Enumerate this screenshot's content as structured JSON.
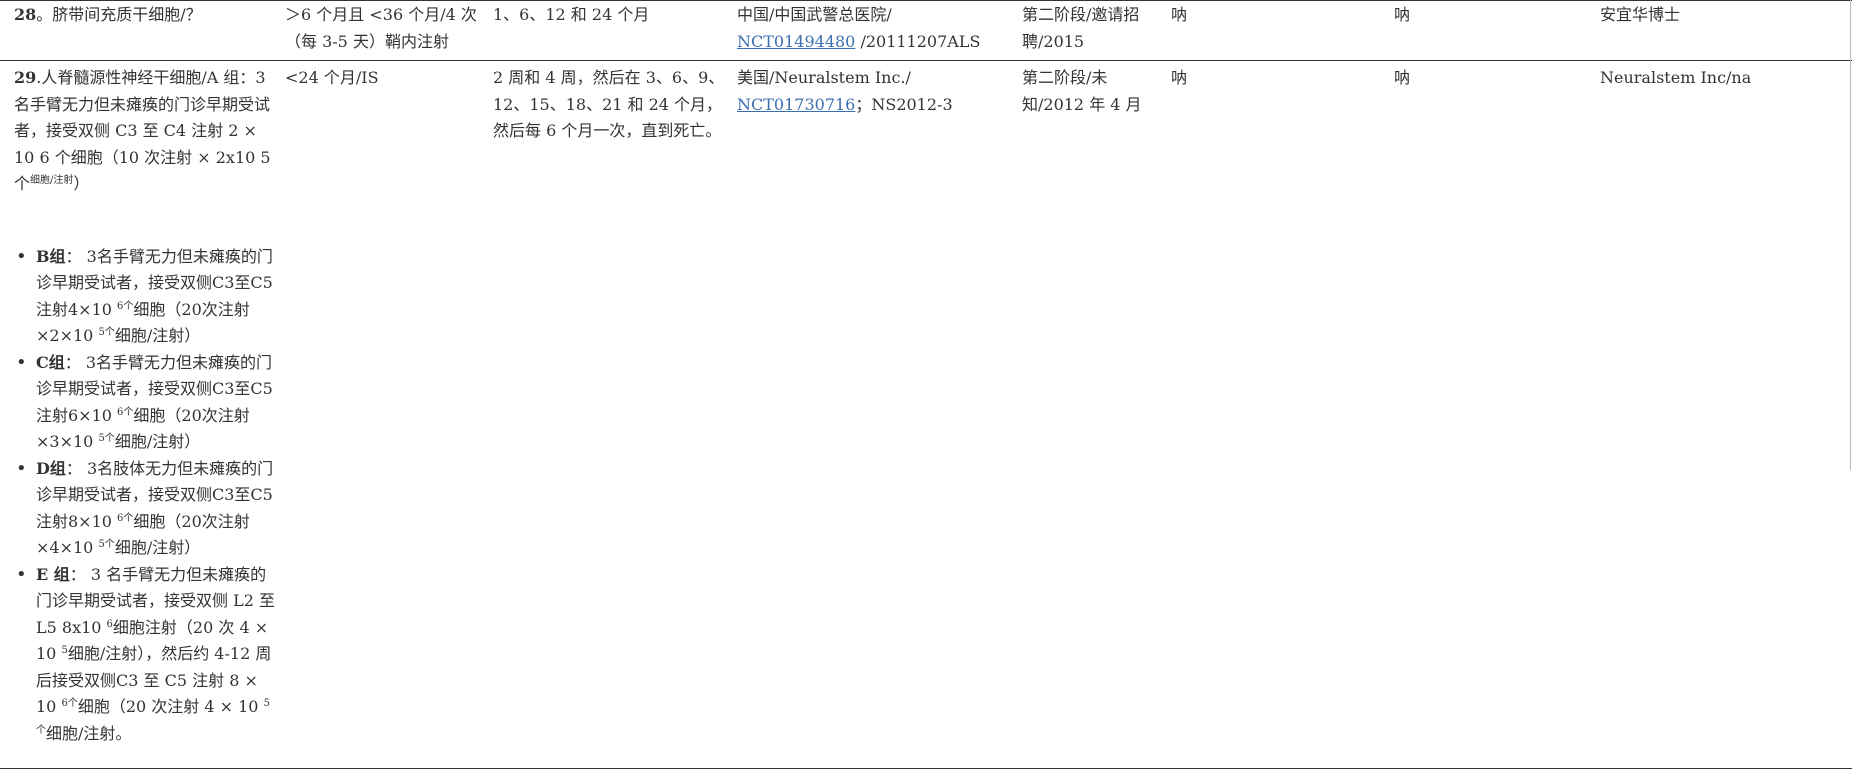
{
  "rows": [
    {
      "number": "28",
      "sep": "。",
      "cells": {
        "c1_text": "脐带间充质干细胞/？",
        "c2": "＞6 个月且 <36 个月/4 次（每 3-5 天）鞘内注射",
        "c3": "1、6、12 和 24 个月",
        "c4_before": "中国/中国武警总医院/",
        "c4_link": "NCT01494480",
        "c4_after": " /20111207ALS",
        "c5": "第二阶段/邀请招聘/2015",
        "c6": "呐",
        "c7": "呐",
        "c8": "安宜华博士"
      }
    },
    {
      "number": "29",
      "sep": ".",
      "cells": {
        "c1_intro": "人脊髓源性神经干细胞/A 组：3 名手臂无力但未瘫痪的门诊早期受试者，接受双侧 C3 至 C4 注射 2 × 10 6 个细胞（10 次注射 × 2x10 5 个",
        "c1_intro_sup": "细胞/注射",
        "c1_intro_end": "）",
        "groups": [
          {
            "name": "B组",
            "colon": "：",
            "t1": "3名手臂无力但未瘫痪的门诊早期受试者，接受双侧C3至C5注射4×10 ",
            "s1": "6个",
            "t2": "细胞（20次注射×2×10 ",
            "s2": "5个",
            "t3": "细胞/注射）"
          },
          {
            "name": "C组",
            "colon": "：",
            "t1": "3名手臂无力但未瘫痪的门诊早期受试者，接受双侧C3至C5注射6×10 ",
            "s1": "6个",
            "t2": "细胞（20次注射×3×10 ",
            "s2": "5个",
            "t3": "细胞/注射）"
          },
          {
            "name": "D组",
            "colon": "：",
            "t1": "3名肢体无力但未瘫痪的门诊早期受试者，接受双侧C3至C5注射8×10 ",
            "s1": "6个",
            "t2": "细胞（20次注射×4×10 ",
            "s2": "5个",
            "t3": "细胞/注射）"
          },
          {
            "name": "E 组",
            "colon": "：",
            "t1": "3 名手臂无力但未瘫痪的门诊早期受试者，接受双侧 L2 至 L5 8x10 ",
            "s1": "6",
            "t2": "细胞注射（20 次 4 × 10 ",
            "s2": "5",
            "t3": "细胞/注射），然后约 4-12 周后接受双侧C3 至 C5 注射 8 × 10 ",
            "s3": "6个",
            "t4": "细胞（20 次注射 4 × 10 ",
            "s4": "5个",
            "t5": "细胞/注射。"
          }
        ],
        "c2": "<24 个月/IS",
        "c3": "2 周和 4 周，然后在 3、6、9、12、15、18、21 和 24 个月，然后每 6 个月一次，直到死亡。",
        "c4_before": "美国/Neuralstem Inc./",
        "c4_link": "NCT01730716",
        "c4_after": "；NS2012-3",
        "c5": "第二阶段/未知/2012 年 4 月",
        "c6": "呐",
        "c7": "呐",
        "c8": "Neuralstem Inc/na"
      }
    }
  ]
}
